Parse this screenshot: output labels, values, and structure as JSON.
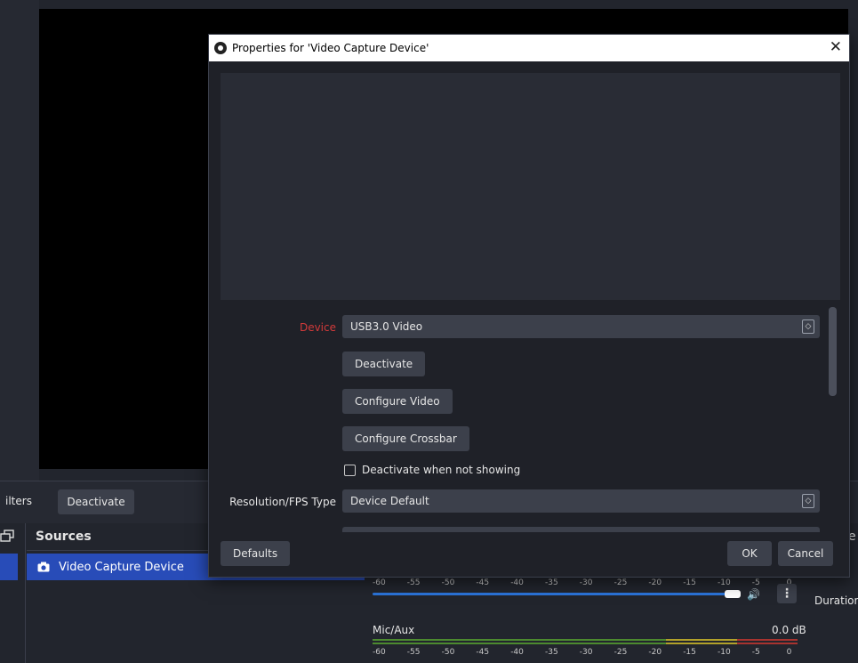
{
  "background": {
    "filters_label": "ilters",
    "deactivate_label": "Deactivate",
    "sources_title": "Sources",
    "source_item": "Video Capture Device",
    "right_header_partial": "e",
    "duration_label": "Duratior",
    "mixer": {
      "ticks": [
        "-60",
        "-55",
        "-50",
        "-45",
        "-40",
        "-35",
        "-30",
        "-25",
        "-20",
        "-15",
        "-10",
        "-5",
        "0"
      ],
      "channel2_name": "Mic/Aux",
      "channel2_level": "0.0 dB",
      "colors": {
        "green": "#4c8a2f",
        "yellow": "#b2a12a",
        "red": "#a8332f",
        "accent": "#2b74d9"
      }
    }
  },
  "dialog": {
    "title": "Properties for 'Video Capture Device'",
    "close_glyph": "✕",
    "device_label": "Device",
    "device_value": "USB3.0 Video",
    "deactivate_button": "Deactivate",
    "configure_video_button": "Configure Video",
    "configure_crossbar_button": "Configure Crossbar",
    "deactivate_when_not_showing": "Deactivate when not showing",
    "resolution_label": "Resolution/FPS Type",
    "resolution_value": "Device Default",
    "defaults_button": "Defaults",
    "ok_button": "OK",
    "cancel_button": "Cancel",
    "colors": {
      "device_label": "#d23a3a",
      "titlebar": "#ffffff"
    }
  }
}
